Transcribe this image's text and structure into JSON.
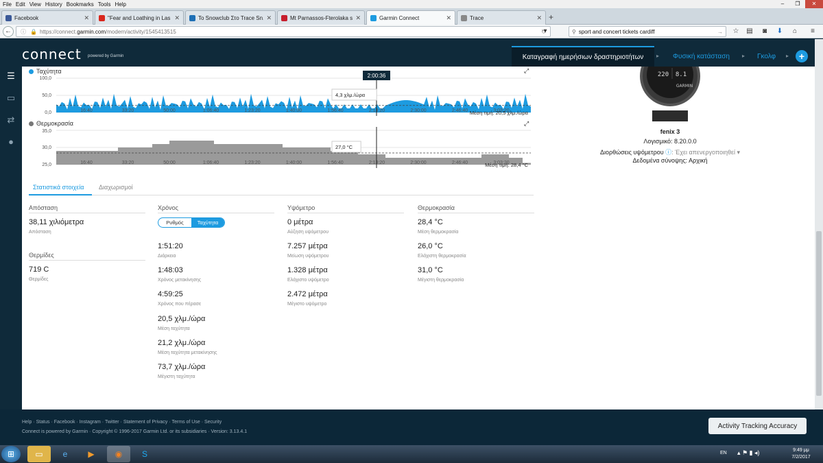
{
  "browser": {
    "menu": [
      "File",
      "Edit",
      "View",
      "History",
      "Bookmarks",
      "Tools",
      "Help"
    ],
    "tabs": [
      {
        "label": "Facebook",
        "color": "#3b5998"
      },
      {
        "label": "\"Fear and Loathing in Las V...",
        "color": "#d9261c"
      },
      {
        "label": "To Snowclub Στο Trace Sn...",
        "color": "#1e6fb5"
      },
      {
        "label": "Mt Parnassos-Fterolaka sn...",
        "color": "#c71e2d"
      },
      {
        "label": "Garmin Connect",
        "color": "#1d9be0"
      },
      {
        "label": "Trace",
        "color": "#888888"
      }
    ],
    "url_prefix": "https://connect.",
    "url_host": "garmin.com",
    "url_path": "/modern/activity/1545413515",
    "search_value": "sport and concert tickets cardiff"
  },
  "header": {
    "logo": "connect",
    "logo_sub": "powered by Garmin",
    "tab_daily": "Καταγραφή ημερήσιων δραστηριοτήτων",
    "tab_fitness": "Φυσική κατάσταση",
    "tab_golf": "Γκολφ",
    "plus": "+"
  },
  "speed_chart": {
    "label": "Ταχύτητα",
    "color": "#1d9be0",
    "y_ticks": [
      "100,0",
      "50,0",
      "0,0"
    ],
    "x_ticks": [
      "16:40",
      "33:20",
      "50:00",
      "1:06:40",
      "1:23:20",
      "1:40:00",
      "1:56:40",
      "2:13:20",
      "2:30:00",
      "2:46:40",
      "3:03:20"
    ],
    "cursor_time": "2:00:36",
    "cursor_value": "4,3 χλμ./ώρα",
    "avg_label": "Μέση τιμή: 20,5 χλμ./ώρα",
    "avg_value": 20.5
  },
  "temp_chart": {
    "label": "Θερμοκρασία",
    "color": "#777777",
    "y_ticks": [
      "35,0",
      "30,0",
      "25,0"
    ],
    "x_ticks": [
      "16:40",
      "33:20",
      "50:00",
      "1:06:40",
      "1:23:20",
      "1:40:00",
      "1:56:40",
      "2:13:20",
      "2:30:00",
      "2:46:40",
      "3:03:20"
    ],
    "cursor_value": "27,0 °C",
    "avg_label": "Μέση τιμή: 28,4 °C",
    "avg_value": 28.4
  },
  "device": {
    "name": "fenix 3",
    "software": "Λογισμικό: 8.20.0.0",
    "altimeter_label": "Διορθώσεις υψόμετρου",
    "altimeter_value": ": Έχει απενεργοποιηθεί",
    "sync": "Δεδομένα σύνοψης: Αρχική",
    "face_values": [
      "220",
      "8.1"
    ],
    "face_brand": "GARMIN"
  },
  "stats_tabs": [
    "Στατιστικά στοιχεία",
    "Διαχωρισμοί"
  ],
  "toggle": [
    "Ρυθμός",
    "Ταχύτητα"
  ],
  "stats": {
    "distance": {
      "header": "Απόσταση",
      "items": [
        {
          "value": "38,11 χιλιόμετρα",
          "label": "Απόσταση"
        }
      ]
    },
    "calories": {
      "header": "Θερμίδες",
      "items": [
        {
          "value": "719 C",
          "label": "Θερμίδες"
        }
      ]
    },
    "time": {
      "header": "Χρόνος",
      "items": [
        {
          "value": "1:51:20",
          "label": "Διάρκεια"
        },
        {
          "value": "1:48:03",
          "label": "Χρόνος μετακίνησης"
        },
        {
          "value": "4:59:25",
          "label": "Χρόνος που πέρασε"
        },
        {
          "value": "20,5 χλμ./ώρα",
          "label": "Μέση ταχύτητα"
        },
        {
          "value": "21,2 χλμ./ώρα",
          "label": "Μέση ταχύτητα μετακίνησης"
        },
        {
          "value": "73,7 χλμ./ώρα",
          "label": "Μέγιστη ταχύτητα"
        }
      ]
    },
    "elevation": {
      "header": "Υψόμετρο",
      "items": [
        {
          "value": "0 μέτρα",
          "label": "Αύξηση υψόμετρου"
        },
        {
          "value": "7.257 μέτρα",
          "label": "Μείωση υψόμετρου"
        },
        {
          "value": "1.328 μέτρα",
          "label": "Ελάχιστο υψόμετρο"
        },
        {
          "value": "2.472 μέτρα",
          "label": "Μέγιστο υψόμετρο"
        }
      ]
    },
    "temperature": {
      "header": "Θερμοκρασία",
      "items": [
        {
          "value": "28,4 °C",
          "label": "Μέση θερμοκρασία"
        },
        {
          "value": "26,0 °C",
          "label": "Ελάχιστη θερμοκρασία"
        },
        {
          "value": "31,0 °C",
          "label": "Μέγιστη θερμοκρασία"
        }
      ]
    }
  },
  "footer": {
    "links": [
      "Help",
      "Status",
      "Facebook",
      "Instagram",
      "Twitter",
      "Statement of Privacy",
      "Terms of Use",
      "Security"
    ],
    "copyright": "Connect is powered by Garmin · Copyright © 1996-2017 Garmin Ltd. or its subsidiaries · Version: 3.13.4.1",
    "accuracy_button": "Activity Tracking Accuracy"
  },
  "taskbar": {
    "lang": "EN",
    "time": "9:49 μμ",
    "date": "7/2/2017"
  }
}
